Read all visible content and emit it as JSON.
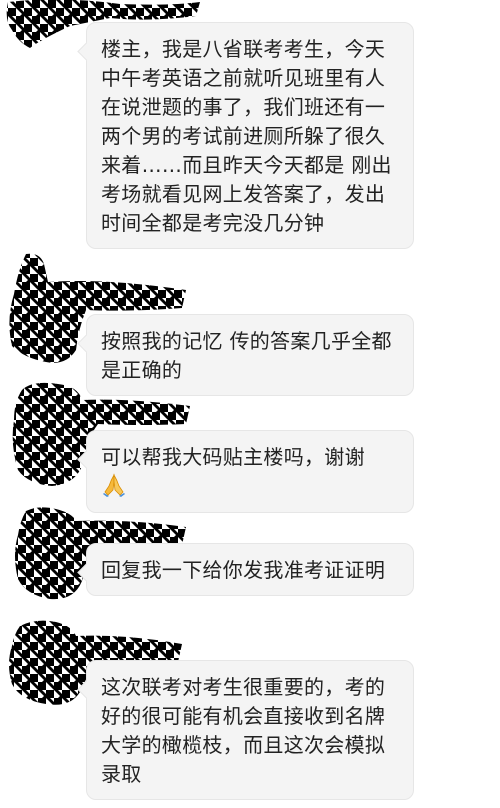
{
  "messages": [
    {
      "text": "楼主，我是八省联考考生，今天中午考英语之前就听见班里有人在说泄题的事了，我们班还有一两个男的考试前进厕所躲了很久来着……而且昨天今天都是 刚出考场就看见网上发答案了，发出时间全都是考完没几分钟",
      "emoji": ""
    },
    {
      "text": "按照我的记忆 传的答案几乎全都是正确的",
      "emoji": ""
    },
    {
      "text": "可以帮我大码贴主楼吗，谢谢",
      "emoji": "folded-hands-emoji"
    },
    {
      "text": "回复我一下给你发我准考证证明",
      "emoji": ""
    },
    {
      "text": "这次联考对考生很重要的，考的好的很可能有机会直接收到名牌大学的橄榄枝，而且这次会模拟录取",
      "emoji": ""
    }
  ],
  "colors": {
    "bubble_bg": "#f4f4f4",
    "bubble_border": "#e6e6e6",
    "text": "#222222",
    "avatar_pattern": "#000000"
  }
}
